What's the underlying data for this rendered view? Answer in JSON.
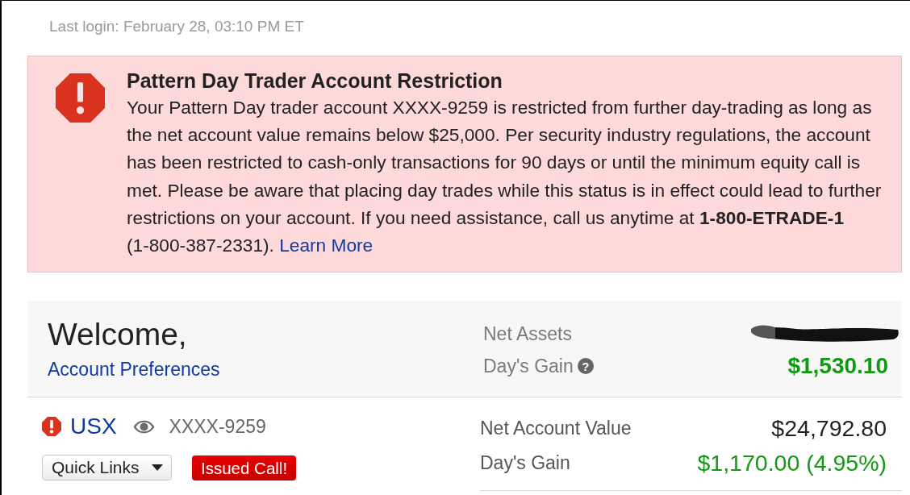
{
  "last_login": "Last login: February 28, 03:10 PM ET",
  "alert": {
    "kind": "error",
    "title": "Pattern Day Trader Account Restriction",
    "message": "Your Pattern Day trader account XXXX-9259 is restricted from further day-trading as long as the net account value remains below $25,000. Per security industry regulations, the account has been restricted to cash-only transactions for 90 days or until the minimum equity call is met. Please be aware that placing day trades while this status is in effect could lead to further restrictions on your account. If you need assistance, call us anytime at **1-800-ETRADE-1**",
    "phone": "(1-800-387-2331).",
    "link": "Learn More"
  },
  "summary": {
    "greeting": "Welcome,",
    "preferences_link": "Account Preferences",
    "net_assets": {
      "label": "Net Assets",
      "redacted": true
    },
    "days_gain": {
      "label": "Day's Gain",
      "help": "?",
      "value": "$1,530.10"
    }
  },
  "accounts": [
    {
      "name": "USX",
      "alert": true,
      "number": "XXXX-9259",
      "quick_links": "Quick Links",
      "badge": "Issued Call!",
      "metrics": [
        {
          "label": "Net Account Value",
          "value": "$24,792.80",
          "color": "#222222"
        },
        {
          "label": "Day's Gain",
          "value": "$1,170.00 (4.95%)",
          "color": "#119a11"
        }
      ]
    }
  ]
}
